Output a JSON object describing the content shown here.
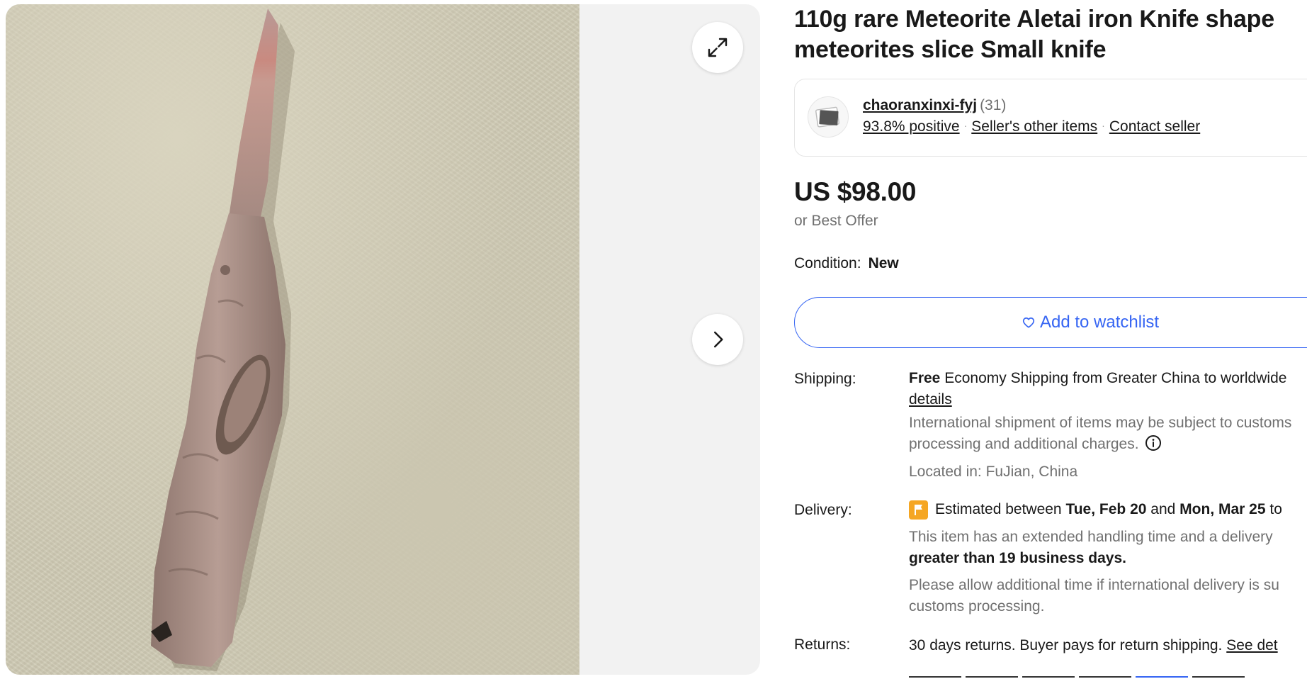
{
  "listing": {
    "title": "110g rare Meteorite Aletai iron Knife shape meteorites slice Small knife",
    "image_alt": "meteorite-knife-photo"
  },
  "gallery": {
    "expand_icon": "expand-icon",
    "next_icon": "chevron-right-icon"
  },
  "seller": {
    "name": "chaoranxinxi-fyj",
    "feedback_count": "(31)",
    "positive": "93.8% positive",
    "other_items": "Seller's other items",
    "contact": "Contact seller",
    "separator": "·"
  },
  "price": {
    "amount": "US $98.00",
    "best_offer": "or Best Offer"
  },
  "condition": {
    "label": "Condition:",
    "value": "New"
  },
  "watchlist": {
    "label": "Add to watchlist"
  },
  "shipping": {
    "label": "Shipping:",
    "free": "Free",
    "method": "Economy Shipping from Greater China to worldwide",
    "details_link": "details",
    "note_line1": "International shipment of items may be subject to customs",
    "note_line2": "processing and additional charges.",
    "location": "Located in: FuJian, China"
  },
  "delivery": {
    "label": "Delivery:",
    "estimate_prefix": "Estimated between",
    "date_start": "Tue, Feb 20",
    "and": "and",
    "date_end": "Mon, Mar 25",
    "estimate_suffix": "to",
    "handling_line1": "This item has an extended handling time and a delivery",
    "handling_line2": "greater than 19 business days.",
    "intl_line1": "Please allow additional time if international delivery is su",
    "intl_line2": "customs processing."
  },
  "returns": {
    "label": "Returns:",
    "text": "30 days returns. Buyer pays for return shipping.",
    "link": "See det"
  },
  "colors": {
    "accent_blue": "#3665f3",
    "text": "#191919",
    "muted": "#707070",
    "flag": "#f5a623"
  }
}
